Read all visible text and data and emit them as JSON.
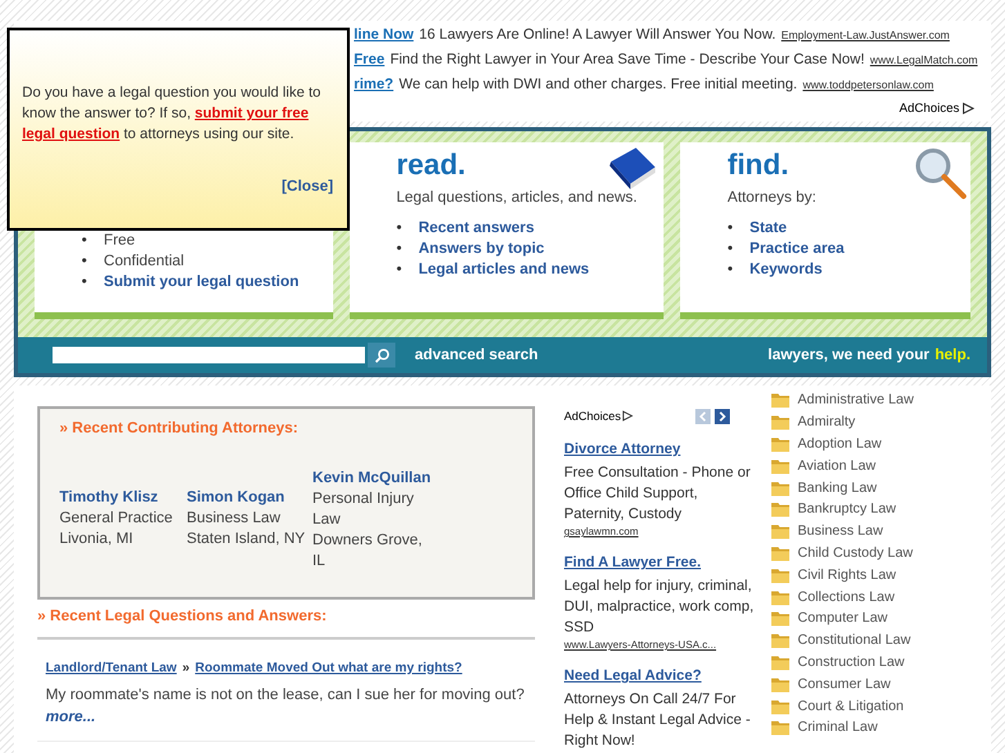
{
  "popup": {
    "text": "Do you have a legal question you would like to know the answer to? If so, **submit your free legal question** to attorneys using our site.",
    "close": "[Close]"
  },
  "top_ads": [
    {
      "title": "line Now",
      "text": "16 Lawyers Are Online! A Lawyer Will Answer You Now.",
      "url": "Employment-Law.JustAnswer.com"
    },
    {
      "title": "Free",
      "text": "Find the Right Lawyer in Your Area Save Time - Describe Your Case Now!",
      "url": "www.LegalMatch.com"
    },
    {
      "title": "rime?",
      "text": "We can help with DWI and other charges. Free initial meeting.",
      "url": "www.toddpetersonlaw.com"
    }
  ],
  "top_adchoices": "AdChoices",
  "cards": [
    {
      "items": [
        {
          "marker": "•",
          "text": "Free",
          "link": false
        },
        {
          "marker": "•",
          "text": "Confidential",
          "link": false
        },
        {
          "marker": "•",
          "text": "Submit your legal question",
          "link": true
        }
      ]
    },
    {
      "heading": "read.",
      "subtitle": "Legal questions, articles, and news.",
      "items": [
        {
          "marker": "•",
          "text": "Recent answers",
          "link": true
        },
        {
          "marker": "•",
          "text": "Answers by topic",
          "link": true
        },
        {
          "marker": "•",
          "text": "Legal articles and news",
          "link": true
        }
      ]
    },
    {
      "heading": "find.",
      "subtitle": "Attorneys by:",
      "items": [
        {
          "marker": "•",
          "text": "State",
          "link": true
        },
        {
          "marker": "•",
          "text": "Practice area",
          "link": true
        },
        {
          "marker": "•",
          "text": "Keywords",
          "link": true
        }
      ]
    }
  ],
  "search": {
    "advanced": "advanced search",
    "tagline": "lawyers, we need your",
    "tagline_link": "help."
  },
  "attorneys": {
    "heading": "» Recent Contributing Attorneys:",
    "people": [
      {
        "name": "Timothy Klisz",
        "practice": "General Practice",
        "location": "Livonia, MI"
      },
      {
        "name": "Simon Kogan",
        "practice": "Business Law",
        "location": "Staten Island, NY"
      },
      {
        "name": "Kevin McQuillan",
        "practice": "Personal Injury Law",
        "location": "Downers Grove, IL"
      }
    ]
  },
  "questions": {
    "heading": "» Recent Legal Questions and Answers:",
    "items": [
      {
        "category": "Landlord/Tenant Law",
        "separator": "»",
        "title": "Roommate Moved Out what are my rights?",
        "text": "My roommate's name is not on the lease, can I sue her for moving out?",
        "more": "more..."
      }
    ]
  },
  "side_ads": {
    "adchoices": "AdChoices",
    "prev_enabled": false,
    "next_enabled": true,
    "ads": [
      {
        "title": "Divorce Attorney",
        "text": "Free Consultation - Phone or Office Child Support, Paternity, Custody",
        "url": "gsaylawmn.com"
      },
      {
        "title": "Find A Lawyer Free.",
        "text": "Legal help for injury, criminal, DUI, malpractice, work comp, SSD",
        "url": "www.Lawyers-Attorneys-USA.c..."
      },
      {
        "title": "Need Legal Advice?",
        "text": "Attorneys On Call 24/7 For Help & Instant Legal Advice - Right Now!"
      }
    ]
  },
  "categories": [
    "Administrative Law",
    "Admiralty",
    "Adoption Law",
    "Aviation Law",
    "Banking Law",
    "Bankruptcy Law",
    "Business Law",
    "Child Custody Law",
    "Civil Rights Law",
    "Collections Law",
    "Computer Law",
    "Constitutional Law",
    "Construction Law",
    "Consumer Law",
    "Court & Litigation",
    "Criminal Law"
  ]
}
